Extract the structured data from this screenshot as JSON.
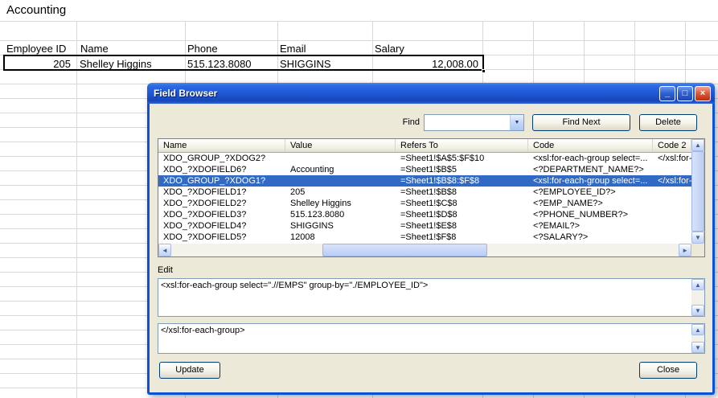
{
  "spreadsheet": {
    "title_cell": "Accounting",
    "columns": [
      "Employee ID",
      "Name",
      "Phone",
      "Email",
      "Salary"
    ],
    "row": {
      "employee_id": "205",
      "name": "Shelley Higgins",
      "phone": "515.123.8080",
      "email": "SHIGGINS",
      "salary": "12,008.00"
    }
  },
  "dialog": {
    "title": "Field Browser",
    "titlebar_icons": {
      "minimize": "_",
      "maximize": "□",
      "close": "×"
    },
    "find": {
      "label": "Find",
      "value": "",
      "button_find_next": "Find Next",
      "button_delete": "Delete"
    },
    "table": {
      "columns": [
        "Name",
        "Value",
        "Refers To",
        "Code",
        "Code 2"
      ],
      "selected_row_index": 2,
      "rows": [
        {
          "name": "XDO_GROUP_?XDOG2?",
          "value": "",
          "refers_to": "=Sheet1!$A$5:$F$10",
          "code": "<xsl:for-each-group select=...",
          "code2": "</xsl:for-each..."
        },
        {
          "name": "XDO_?XDOFIELD6?",
          "value": "Accounting",
          "refers_to": "=Sheet1!$B$5",
          "code": "<?DEPARTMENT_NAME?>",
          "code2": ""
        },
        {
          "name": "XDO_GROUP_?XDOG1?",
          "value": "",
          "refers_to": "=Sheet1!$B$8:$F$8",
          "code": "<xsl:for-each-group select=...",
          "code2": "</xsl:for-each"
        },
        {
          "name": "XDO_?XDOFIELD1?",
          "value": "205",
          "refers_to": "=Sheet1!$B$8",
          "code": "<?EMPLOYEE_ID?>",
          "code2": ""
        },
        {
          "name": "XDO_?XDOFIELD2?",
          "value": "Shelley Higgins",
          "refers_to": "=Sheet1!$C$8",
          "code": "<?EMP_NAME?>",
          "code2": ""
        },
        {
          "name": "XDO_?XDOFIELD3?",
          "value": "515.123.8080",
          "refers_to": "=Sheet1!$D$8",
          "code": "<?PHONE_NUMBER?>",
          "code2": ""
        },
        {
          "name": "XDO_?XDOFIELD4?",
          "value": "SHIGGINS",
          "refers_to": "=Sheet1!$E$8",
          "code": "<?EMAIL?>",
          "code2": ""
        },
        {
          "name": "XDO_?XDOFIELD5?",
          "value": "12008",
          "refers_to": "=Sheet1!$F$8",
          "code": "<?SALARY?>",
          "code2": ""
        }
      ]
    },
    "edit": {
      "label": "Edit",
      "box1": "<xsl:for-each-group select=\".//EMPS\" group-by=\"./EMPLOYEE_ID\">",
      "box2": "</xsl:for-each-group>"
    },
    "buttons": {
      "update": "Update",
      "close": "Close"
    }
  },
  "icons": {
    "dropdown": "▼",
    "up": "▲",
    "down": "▼",
    "left": "◄",
    "right": "►"
  },
  "colors": {
    "selection": "#316AC5",
    "dialog_bg": "#ECE9D8",
    "titlebar_blue": "#1D55D2"
  }
}
